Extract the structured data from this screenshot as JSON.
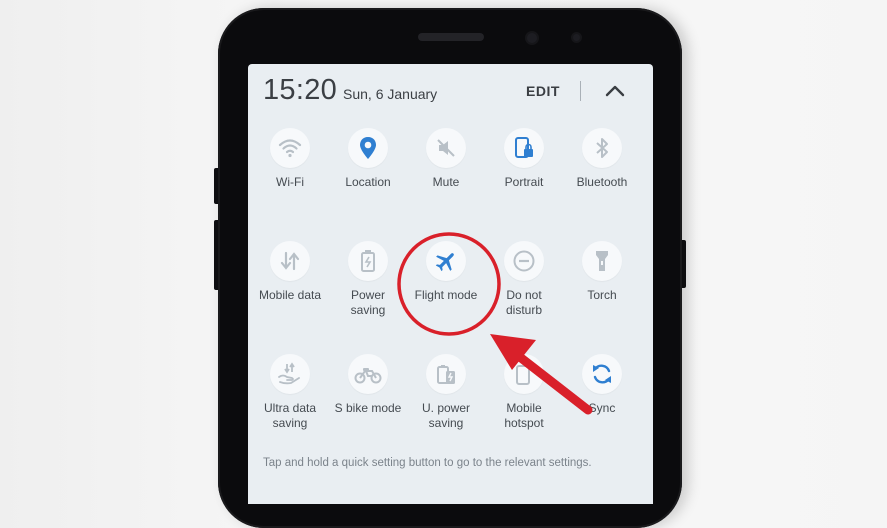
{
  "statusbar": {
    "time": "15:20",
    "date": "Sun, 6 January",
    "edit_label": "EDIT"
  },
  "tiles": [
    {
      "icon": "wifi-icon",
      "label": "Wi-Fi"
    },
    {
      "icon": "location-icon",
      "label": "Location"
    },
    {
      "icon": "mute-icon",
      "label": "Mute"
    },
    {
      "icon": "portrait-lock-icon",
      "label": "Portrait"
    },
    {
      "icon": "bluetooth-icon",
      "label": "Bluetooth"
    },
    {
      "icon": "mobile-data-icon",
      "label": "Mobile data"
    },
    {
      "icon": "battery-icon",
      "label": "Power saving"
    },
    {
      "icon": "airplane-icon",
      "label": "Flight mode"
    },
    {
      "icon": "do-not-disturb-icon",
      "label": "Do not disturb"
    },
    {
      "icon": "torch-icon",
      "label": "Torch"
    },
    {
      "icon": "ultra-data-saving-icon",
      "label": "Ultra data saving"
    },
    {
      "icon": "bike-icon",
      "label": "S bike mode"
    },
    {
      "icon": "ultra-power-saving-icon",
      "label": "U. power saving"
    },
    {
      "icon": "hotspot-icon",
      "label": "Mobile hotspot"
    },
    {
      "icon": "sync-icon",
      "label": "Sync"
    }
  ],
  "hint": "Tap and hold a quick setting button to go to the relevant settings.",
  "colors": {
    "accent": "#2f7fd1",
    "inactive_icon": "#b8c0c7",
    "annotation": "#d9202a"
  }
}
